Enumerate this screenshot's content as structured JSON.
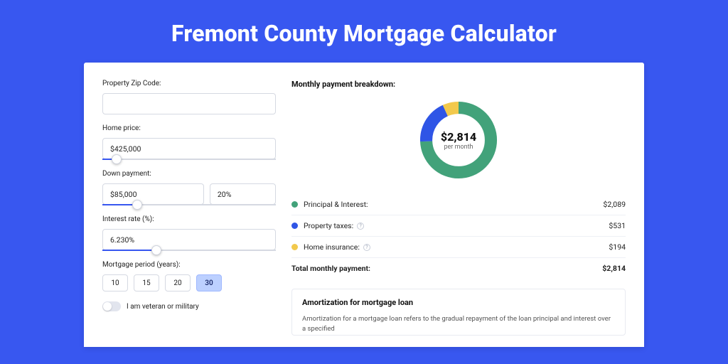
{
  "title": "Fremont County Mortgage Calculator",
  "form": {
    "zip_label": "Property Zip Code:",
    "zip_value": "",
    "price_label": "Home price:",
    "price_value": "$425,000",
    "price_slider_pct": 8,
    "down_label": "Down payment:",
    "down_value": "$85,000",
    "down_pct_value": "20%",
    "down_slider_pct": 20,
    "rate_label": "Interest rate (%):",
    "rate_value": "6.230%",
    "rate_slider_pct": 31,
    "period_label": "Mortgage period (years):",
    "periods": [
      "10",
      "15",
      "20",
      "30"
    ],
    "period_active": "30",
    "veteran_label": "I am veteran or military"
  },
  "breakdown": {
    "heading": "Monthly payment breakdown:",
    "center_amount": "$2,814",
    "center_sub": "per month",
    "items": [
      {
        "label": "Principal & Interest:",
        "value": "$2,089",
        "help": false,
        "colorClass": "green"
      },
      {
        "label": "Property taxes:",
        "value": "$531",
        "help": true,
        "colorClass": "blue"
      },
      {
        "label": "Home insurance:",
        "value": "$194",
        "help": true,
        "colorClass": "yellow"
      }
    ],
    "total_label": "Total monthly payment:",
    "total_value": "$2,814"
  },
  "chart_data": {
    "type": "pie",
    "title": "Monthly payment breakdown",
    "series": [
      {
        "name": "Principal & Interest",
        "value": 2089
      },
      {
        "name": "Property taxes",
        "value": 531
      },
      {
        "name": "Home insurance",
        "value": 194
      }
    ],
    "total": 2814,
    "colors": {
      "Principal & Interest": "#42a27a",
      "Property taxes": "#2f55e6",
      "Home insurance": "#f2c94c"
    }
  },
  "amort": {
    "heading": "Amortization for mortgage loan",
    "body": "Amortization for a mortgage loan refers to the gradual repayment of the loan principal and interest over a specified"
  }
}
